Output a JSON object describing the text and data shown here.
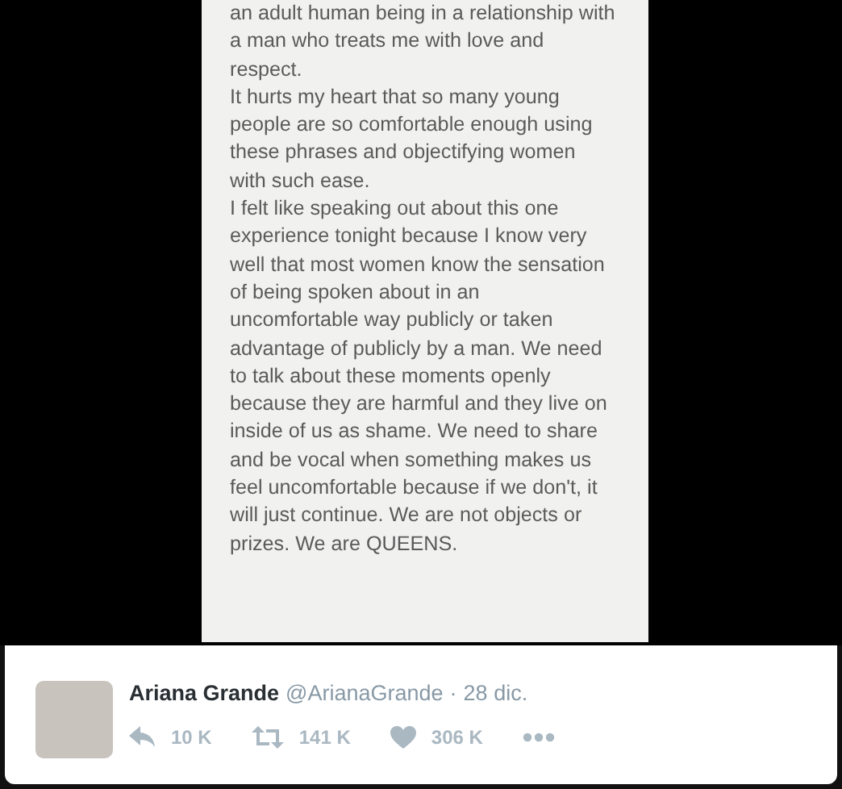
{
  "note": {
    "paragraphs": [
      {
        "lines": [
          "an adult human being in a relationship with",
          "a man who treats me with love and",
          "respect."
        ]
      },
      {
        "lines": [
          "It hurts my heart that so many young",
          "people are so comfortable enough using",
          "these phrases and objectifying women",
          "with such ease."
        ]
      },
      {
        "lines": [
          "I felt like speaking out about this one",
          "experience tonight because I know very",
          "well that most women know the sensation",
          "of being spoken about in an",
          "uncomfortable way publicly or taken",
          "advantage of publicly by a man. We need",
          "to talk about these moments openly",
          "because they are harmful and they live on",
          "inside of us as shame. We need to share",
          "and be vocal when something makes us",
          "feel uncomfortable because if we don't, it",
          "will just continue. We are not objects or",
          "prizes. We are QUEENS."
        ]
      }
    ]
  },
  "tweet": {
    "name": "Ariana Grande",
    "handle": "@ArianaGrande",
    "separator": "·",
    "date": "28 dic.",
    "actions": [
      {
        "kind": "reply",
        "count": "10 K"
      },
      {
        "kind": "retweet",
        "count": "141 K"
      },
      {
        "kind": "like",
        "count": "306 K"
      },
      {
        "kind": "more"
      }
    ]
  }
}
